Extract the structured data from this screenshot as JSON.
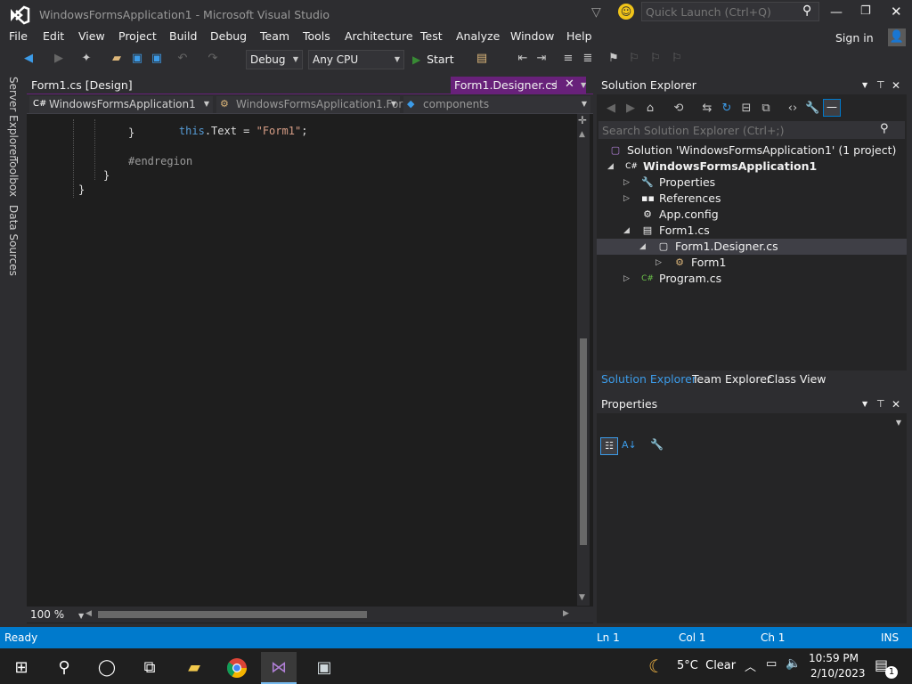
{
  "window": {
    "title": "WindowsFormsApplication1 - Microsoft Visual Studio"
  },
  "quick_launch": {
    "placeholder": "Quick Launch (Ctrl+Q)"
  },
  "menu": {
    "items": [
      "File",
      "Edit",
      "View",
      "Project",
      "Build",
      "Debug",
      "Team",
      "Tools",
      "Architecture",
      "Test",
      "Analyze",
      "Window",
      "Help"
    ],
    "sign_in": "Sign in"
  },
  "toolbar": {
    "config": "Debug",
    "platform": "Any CPU",
    "start_label": "Start"
  },
  "side_tabs": [
    "Server Explorer",
    "Toolbox",
    "Data Sources"
  ],
  "doc_tabs": {
    "inactive": "Form1.cs [Design]",
    "active": "Form1.Designer.cs"
  },
  "nav": {
    "project": "WindowsFormsApplication1",
    "type": "WindowsFormsApplication1.For",
    "member": "components"
  },
  "code": {
    "lines": [
      {
        "kw": "this",
        "rest": ".Text = ",
        "str": "\"Form1\"",
        "end": ";"
      },
      "}",
      "#endregion",
      "}",
      "}"
    ]
  },
  "zoom": "100 %",
  "solution_explorer": {
    "title": "Solution Explorer",
    "search_placeholder": "Search Solution Explorer (Ctrl+;)",
    "tree": [
      "Solution 'WindowsFormsApplication1' (1 project)",
      "WindowsFormsApplication1",
      "Properties",
      "References",
      "App.config",
      "Form1.cs",
      "Form1.Designer.cs",
      "Form1",
      "Program.cs"
    ],
    "bottom_tabs": [
      "Solution Explorer",
      "Team Explorer",
      "Class View"
    ]
  },
  "properties": {
    "title": "Properties"
  },
  "status": {
    "ready": "Ready",
    "ln": "Ln 1",
    "col": "Col 1",
    "ch": "Ch 1",
    "ins": "INS"
  },
  "taskbar": {
    "weather": "5°C  Clear",
    "time": "10:59 PM",
    "date": "2/10/2023",
    "notifications": "1"
  },
  "colors": {
    "accent": "#007acc",
    "active_tab": "#68217a",
    "keyword": "#569cd6",
    "string": "#d69d85",
    "preprocessor": "#9b9b9b"
  }
}
